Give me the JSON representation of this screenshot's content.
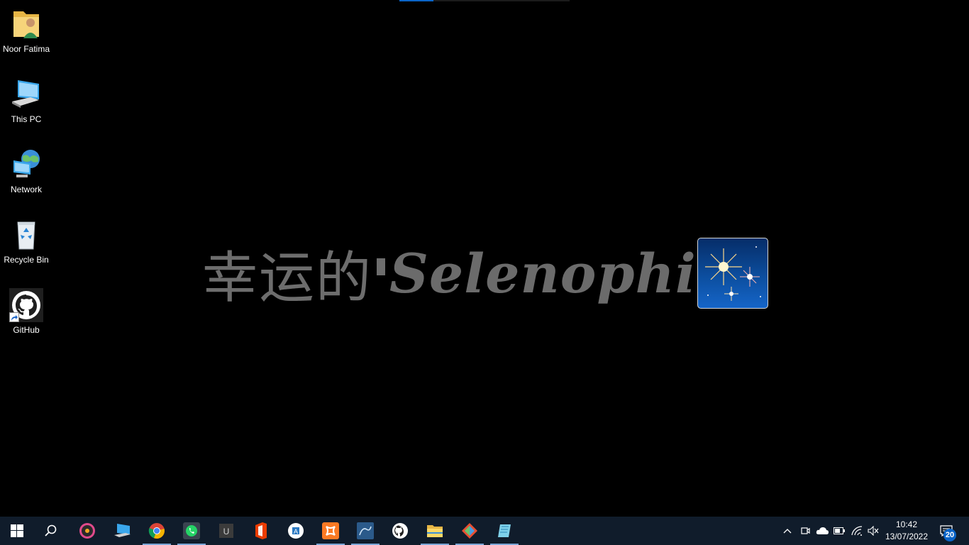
{
  "desktop": {
    "icons": [
      {
        "label": "Noor Fatima",
        "icon": "user-folder-icon"
      },
      {
        "label": "This PC",
        "icon": "computer-icon"
      },
      {
        "label": "Network",
        "icon": "network-icon"
      },
      {
        "label": "Recycle Bin",
        "icon": "recycle-bin-icon"
      },
      {
        "label": "GitHub",
        "icon": "github-icon"
      }
    ],
    "progress_fraction": 0.2
  },
  "wallpaper": {
    "chinese_text": "幸运的",
    "latin_text": "Selenophile",
    "emoji_icon": "fireworks-icon"
  },
  "taskbar": {
    "apps": [
      {
        "icon": "start-icon"
      },
      {
        "icon": "search-icon"
      },
      {
        "icon": "groove-music-icon"
      },
      {
        "icon": "remote-desktop-icon"
      },
      {
        "icon": "chrome-icon"
      },
      {
        "icon": "whatsapp-icon"
      },
      {
        "icon": "udemy-icon"
      },
      {
        "icon": "office-icon"
      },
      {
        "icon": "wordpad-icon"
      },
      {
        "icon": "xampp-icon"
      },
      {
        "icon": "mysql-workbench-icon"
      },
      {
        "icon": "github-desktop-icon"
      },
      {
        "icon": "file-explorer-icon"
      },
      {
        "icon": "git-gui-icon"
      },
      {
        "icon": "notes-icon"
      }
    ],
    "tray": {
      "time": "10:42",
      "date": "13/07/2022",
      "notification_count": "20"
    }
  },
  "colors": {
    "taskbar_bg": "#101c2b",
    "accent": "#0a64c8",
    "wallpaper_text": "#6d6d6d"
  }
}
